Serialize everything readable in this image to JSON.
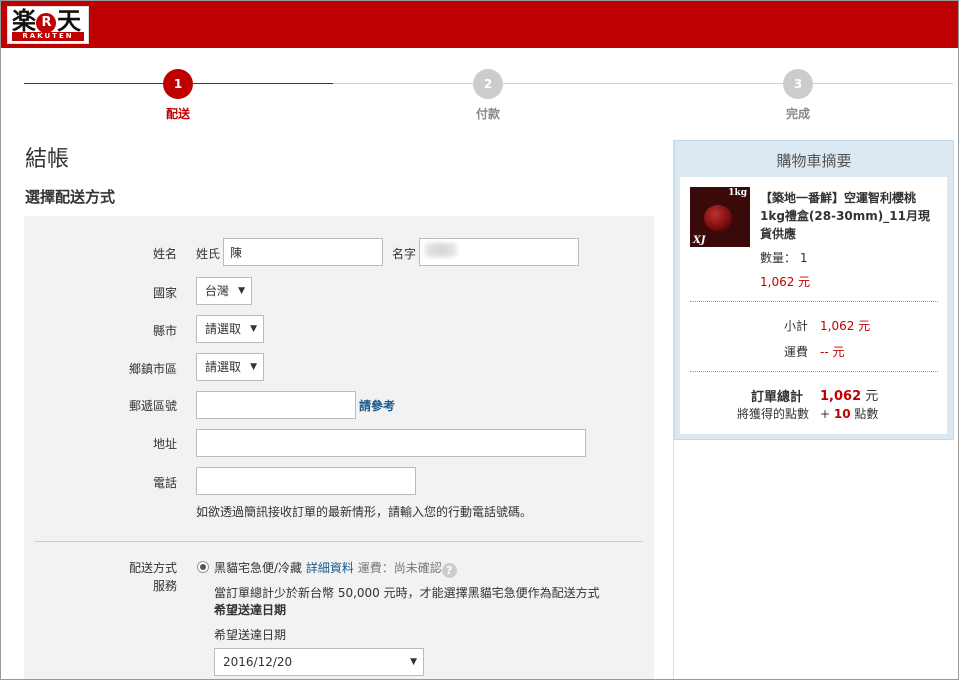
{
  "brand": {
    "logo_text": "楽天",
    "logo_word": "RAKUTEN"
  },
  "steps": [
    {
      "number": "1",
      "label": "配送",
      "active": true
    },
    {
      "number": "2",
      "label": "付款",
      "active": false
    },
    {
      "number": "3",
      "label": "完成",
      "active": false
    }
  ],
  "page_title": "結帳",
  "section_title": "選擇配送方式",
  "form": {
    "name_label": "姓名",
    "surname_label": "姓氏",
    "surname_value": "陳",
    "given_label": "名字",
    "country_label": "國家",
    "country_value": "台灣",
    "county_label": "縣市",
    "county_value": "請選取",
    "district_label": "鄉鎮市區",
    "district_value": "請選取",
    "postal_label": "郵遞區號",
    "postal_value": "",
    "postal_link": "請參考",
    "address_label": "地址",
    "address_value": "",
    "phone_label": "電話",
    "phone_value": "",
    "phone_hint": "如欲透過簡訊接收訂單的最新情形，請輸入您的行動電話號碼。"
  },
  "shipping": {
    "label_line1": "配送方式",
    "label_line2": "服務",
    "option_label": "黑貓宅急便/冷藏",
    "details_link": "詳細資料",
    "fee_text": "運費：尚未確認",
    "help_icon": "?",
    "notice": "當訂單總計少於新台幣 50,000 元時，才能選擇黑貓宅急便作為配送方式",
    "preferred_heading": "希望送達日期",
    "preferred_label": "希望送達日期",
    "preferred_value": "2016/12/20"
  },
  "cart": {
    "title": "購物車摘要",
    "product_name": "【築地一番鮮】空運智利櫻桃1kg禮盒(28-30mm)_11月現貨供應",
    "image_tag_weight": "1kg",
    "image_tag_size": "XJ",
    "qty_label": "數量：",
    "qty_value": "1",
    "item_price": "1,062 元",
    "subtotal_label": "小計",
    "subtotal_value": "1,062 元",
    "shipping_label": "運費",
    "shipping_value": "-- 元",
    "total_label": "訂單總計",
    "total_value": "1,062",
    "total_unit": "元",
    "points_label": "將獲得的點數",
    "points_prefix": "+",
    "points_value": "10",
    "points_unit": "點數"
  },
  "colors": {
    "brand_red": "#bf0000",
    "link_blue": "#1a5a8a",
    "cart_bg": "#dce8f1"
  }
}
